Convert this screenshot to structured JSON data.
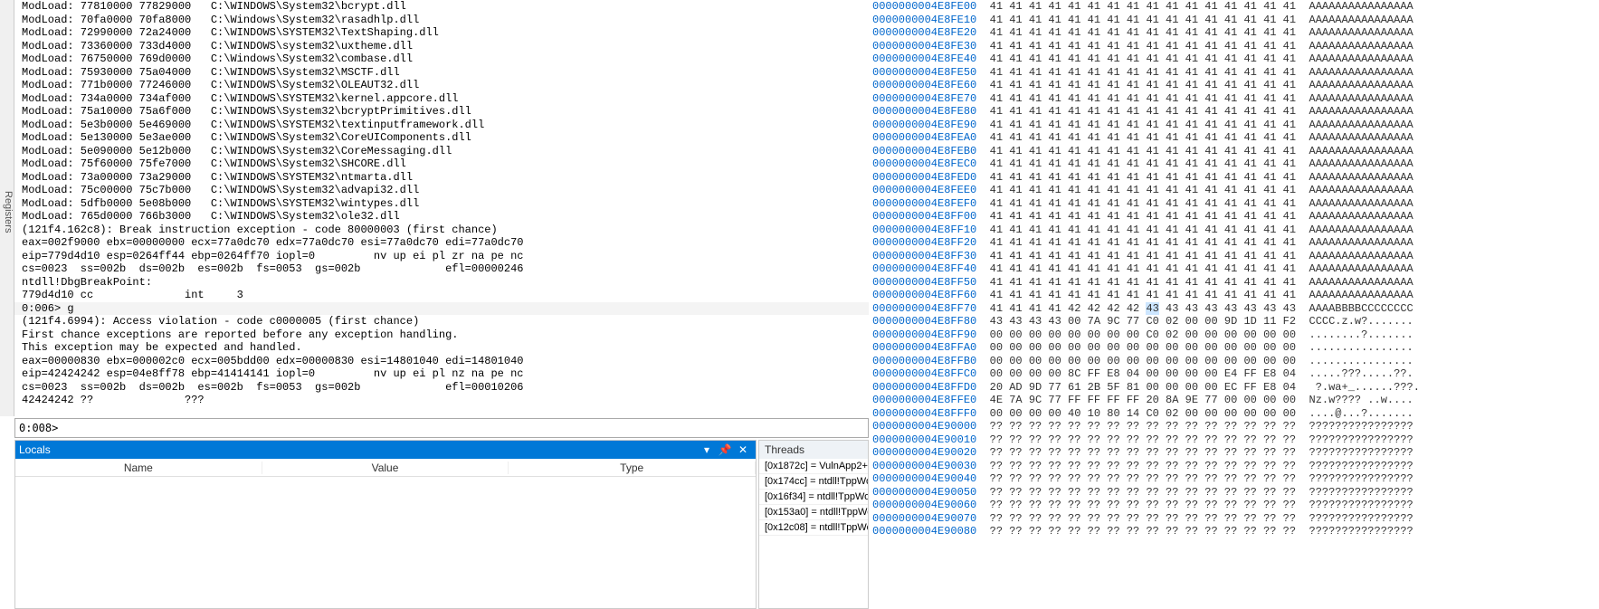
{
  "sidebar": {
    "label": "Registers"
  },
  "command_lines": [
    {
      "t": "ModLoad: 77810000 77829000   C:\\WINDOWS\\System32\\bcrypt.dll"
    },
    {
      "t": "ModLoad: 70fa0000 70fa8000   C:\\Windows\\System32\\rasadhlp.dll"
    },
    {
      "t": "ModLoad: 72990000 72a24000   C:\\WINDOWS\\SYSTEM32\\TextShaping.dll"
    },
    {
      "t": "ModLoad: 73360000 733d4000   C:\\WINDOWS\\system32\\uxtheme.dll"
    },
    {
      "t": "ModLoad: 76750000 769d0000   C:\\Windows\\System32\\combase.dll"
    },
    {
      "t": "ModLoad: 75930000 75a04000   C:\\WINDOWS\\System32\\MSCTF.dll"
    },
    {
      "t": "ModLoad: 771b0000 77246000   C:\\WINDOWS\\System32\\OLEAUT32.dll"
    },
    {
      "t": "ModLoad: 734a0000 734af000   C:\\WINDOWS\\SYSTEM32\\kernel.appcore.dll"
    },
    {
      "t": "ModLoad: 75a10000 75a6f000   C:\\WINDOWS\\System32\\bcryptPrimitives.dll"
    },
    {
      "t": "ModLoad: 5e3b0000 5e469000   C:\\WINDOWS\\SYSTEM32\\textinputframework.dll"
    },
    {
      "t": "ModLoad: 5e130000 5e3ae000   C:\\WINDOWS\\System32\\CoreUIComponents.dll"
    },
    {
      "t": "ModLoad: 5e090000 5e12b000   C:\\WINDOWS\\System32\\CoreMessaging.dll"
    },
    {
      "t": "ModLoad: 75f60000 75fe7000   C:\\WINDOWS\\System32\\SHCORE.dll"
    },
    {
      "t": "ModLoad: 73a00000 73a29000   C:\\WINDOWS\\SYSTEM32\\ntmarta.dll"
    },
    {
      "t": "ModLoad: 75c00000 75c7b000   C:\\WINDOWS\\System32\\advapi32.dll"
    },
    {
      "t": "ModLoad: 5dfb0000 5e08b000   C:\\WINDOWS\\SYSTEM32\\wintypes.dll"
    },
    {
      "t": "ModLoad: 765d0000 766b3000   C:\\WINDOWS\\System32\\ole32.dll"
    },
    {
      "t": "(121f4.162c8): Break instruction exception - code 80000003 (first chance)"
    },
    {
      "t": "eax=002f9000 ebx=00000000 ecx=77a0dc70 edx=77a0dc70 esi=77a0dc70 edi=77a0dc70"
    },
    {
      "t": "eip=779d4d10 esp=0264ff44 ebp=0264ff70 iopl=0         nv up ei pl zr na pe nc"
    },
    {
      "t": "cs=0023  ss=002b  ds=002b  es=002b  fs=0053  gs=002b             efl=00000246"
    },
    {
      "t": "ntdll!DbgBreakPoint:"
    },
    {
      "t": "779d4d10 cc              int     3"
    },
    {
      "t": "0:006> g",
      "hl": true
    },
    {
      "t": "(121f4.6994): Access violation - code c0000005 (first chance)"
    },
    {
      "t": "First chance exceptions are reported before any exception handling."
    },
    {
      "t": "This exception may be expected and handled."
    },
    {
      "t": "eax=00000830 ebx=000002c0 ecx=005bdd00 edx=00000830 esi=14801040 edi=14801040"
    },
    {
      "t": "eip=42424242 esp=04e8ff78 ebp=41414141 iopl=0         nv up ei pl nz na pe nc"
    },
    {
      "t": "cs=0023  ss=002b  ds=002b  es=002b  fs=0053  gs=002b             efl=00010206"
    },
    {
      "t": "42424242 ??              ???"
    }
  ],
  "prompt": "0:008>",
  "input_value": "",
  "locals": {
    "title": "Locals",
    "columns": [
      "Name",
      "Value",
      "Type"
    ]
  },
  "threads": {
    "title": "Threads",
    "items": [
      "[0x1872c] = VulnApp2+",
      "[0x174cc] = ntdll!TppWo",
      "[0x16f34] = ntdll!TppWo",
      "[0x153a0] = ntdll!TppWo",
      "[0x12c08] = ntdll!TppWo"
    ]
  },
  "memory": {
    "rows": [
      {
        "addr": "0000000004E8FE00",
        "hex": "41 41 41 41 41 41 41 41 41 41 41 41 41 41 41 41",
        "asc": "AAAAAAAAAAAAAAAA"
      },
      {
        "addr": "0000000004E8FE10",
        "hex": "41 41 41 41 41 41 41 41 41 41 41 41 41 41 41 41",
        "asc": "AAAAAAAAAAAAAAAA"
      },
      {
        "addr": "0000000004E8FE20",
        "hex": "41 41 41 41 41 41 41 41 41 41 41 41 41 41 41 41",
        "asc": "AAAAAAAAAAAAAAAA"
      },
      {
        "addr": "0000000004E8FE30",
        "hex": "41 41 41 41 41 41 41 41 41 41 41 41 41 41 41 41",
        "asc": "AAAAAAAAAAAAAAAA"
      },
      {
        "addr": "0000000004E8FE40",
        "hex": "41 41 41 41 41 41 41 41 41 41 41 41 41 41 41 41",
        "asc": "AAAAAAAAAAAAAAAA"
      },
      {
        "addr": "0000000004E8FE50",
        "hex": "41 41 41 41 41 41 41 41 41 41 41 41 41 41 41 41",
        "asc": "AAAAAAAAAAAAAAAA"
      },
      {
        "addr": "0000000004E8FE60",
        "hex": "41 41 41 41 41 41 41 41 41 41 41 41 41 41 41 41",
        "asc": "AAAAAAAAAAAAAAAA"
      },
      {
        "addr": "0000000004E8FE70",
        "hex": "41 41 41 41 41 41 41 41 41 41 41 41 41 41 41 41",
        "asc": "AAAAAAAAAAAAAAAA"
      },
      {
        "addr": "0000000004E8FE80",
        "hex": "41 41 41 41 41 41 41 41 41 41 41 41 41 41 41 41",
        "asc": "AAAAAAAAAAAAAAAA"
      },
      {
        "addr": "0000000004E8FE90",
        "hex": "41 41 41 41 41 41 41 41 41 41 41 41 41 41 41 41",
        "asc": "AAAAAAAAAAAAAAAA"
      },
      {
        "addr": "0000000004E8FEA0",
        "hex": "41 41 41 41 41 41 41 41 41 41 41 41 41 41 41 41",
        "asc": "AAAAAAAAAAAAAAAA"
      },
      {
        "addr": "0000000004E8FEB0",
        "hex": "41 41 41 41 41 41 41 41 41 41 41 41 41 41 41 41",
        "asc": "AAAAAAAAAAAAAAAA"
      },
      {
        "addr": "0000000004E8FEC0",
        "hex": "41 41 41 41 41 41 41 41 41 41 41 41 41 41 41 41",
        "asc": "AAAAAAAAAAAAAAAA"
      },
      {
        "addr": "0000000004E8FED0",
        "hex": "41 41 41 41 41 41 41 41 41 41 41 41 41 41 41 41",
        "asc": "AAAAAAAAAAAAAAAA"
      },
      {
        "addr": "0000000004E8FEE0",
        "hex": "41 41 41 41 41 41 41 41 41 41 41 41 41 41 41 41",
        "asc": "AAAAAAAAAAAAAAAA"
      },
      {
        "addr": "0000000004E8FEF0",
        "hex": "41 41 41 41 41 41 41 41 41 41 41 41 41 41 41 41",
        "asc": "AAAAAAAAAAAAAAAA"
      },
      {
        "addr": "0000000004E8FF00",
        "hex": "41 41 41 41 41 41 41 41 41 41 41 41 41 41 41 41",
        "asc": "AAAAAAAAAAAAAAAA"
      },
      {
        "addr": "0000000004E8FF10",
        "hex": "41 41 41 41 41 41 41 41 41 41 41 41 41 41 41 41",
        "asc": "AAAAAAAAAAAAAAAA"
      },
      {
        "addr": "0000000004E8FF20",
        "hex": "41 41 41 41 41 41 41 41 41 41 41 41 41 41 41 41",
        "asc": "AAAAAAAAAAAAAAAA"
      },
      {
        "addr": "0000000004E8FF30",
        "hex": "41 41 41 41 41 41 41 41 41 41 41 41 41 41 41 41",
        "asc": "AAAAAAAAAAAAAAAA"
      },
      {
        "addr": "0000000004E8FF40",
        "hex": "41 41 41 41 41 41 41 41 41 41 41 41 41 41 41 41",
        "asc": "AAAAAAAAAAAAAAAA"
      },
      {
        "addr": "0000000004E8FF50",
        "hex": "41 41 41 41 41 41 41 41 41 41 41 41 41 41 41 41",
        "asc": "AAAAAAAAAAAAAAAA"
      },
      {
        "addr": "0000000004E8FF60",
        "hex": "41 41 41 41 41 41 41 41 41 41 41 41 41 41 41 41",
        "asc": "AAAAAAAAAAAAAAAA"
      },
      {
        "addr": "0000000004E8FF70",
        "hex": "41 41 41 41 42 42 42 42 ",
        "hex_hl": "43",
        "hex2": " 43 43 43 43 43 43 43",
        "asc": "AAAABBBBCCCCCCCC"
      },
      {
        "addr": "0000000004E8FF80",
        "hex": "43 43 43 43 00 7A 9C 77 C0 02 00 00 9D 1D 11 F2",
        "asc": "CCCC.z.w?......."
      },
      {
        "addr": "0000000004E8FF90",
        "hex": "00 00 00 00 00 00 00 00 C0 02 00 00 00 00 00 00",
        "asc": "........?......."
      },
      {
        "addr": "0000000004E8FFA0",
        "hex": "00 00 00 00 00 00 00 00 00 00 00 00 00 00 00 00",
        "asc": "................"
      },
      {
        "addr": "0000000004E8FFB0",
        "hex": "00 00 00 00 00 00 00 00 00 00 00 00 00 00 00 00",
        "asc": "................"
      },
      {
        "addr": "0000000004E8FFC0",
        "hex": "00 00 00 00 8C FF E8 04 00 00 00 00 E4 FF E8 04",
        "asc": ".....???.....??."
      },
      {
        "addr": "0000000004E8FFD0",
        "hex": "20 AD 9D 77 61 2B 5F 81 00 00 00 00 EC FF E8 04",
        "asc": " ?.wa+_......???."
      },
      {
        "addr": "0000000004E8FFE0",
        "hex": "4E 7A 9C 77 FF FF FF FF 20 8A 9E 77 00 00 00 00",
        "asc": "Nz.w???? ..w...."
      },
      {
        "addr": "0000000004E8FFF0",
        "hex": "00 00 00 00 40 10 80 14 C0 02 00 00 00 00 00 00",
        "asc": "....@...?......."
      },
      {
        "addr": "0000000004E90000",
        "hex": "?? ?? ?? ?? ?? ?? ?? ?? ?? ?? ?? ?? ?? ?? ?? ??",
        "asc": "????????????????"
      },
      {
        "addr": "0000000004E90010",
        "hex": "?? ?? ?? ?? ?? ?? ?? ?? ?? ?? ?? ?? ?? ?? ?? ??",
        "asc": "????????????????"
      },
      {
        "addr": "0000000004E90020",
        "hex": "?? ?? ?? ?? ?? ?? ?? ?? ?? ?? ?? ?? ?? ?? ?? ??",
        "asc": "????????????????"
      },
      {
        "addr": "0000000004E90030",
        "hex": "?? ?? ?? ?? ?? ?? ?? ?? ?? ?? ?? ?? ?? ?? ?? ??",
        "asc": "????????????????"
      },
      {
        "addr": "0000000004E90040",
        "hex": "?? ?? ?? ?? ?? ?? ?? ?? ?? ?? ?? ?? ?? ?? ?? ??",
        "asc": "????????????????"
      },
      {
        "addr": "0000000004E90050",
        "hex": "?? ?? ?? ?? ?? ?? ?? ?? ?? ?? ?? ?? ?? ?? ?? ??",
        "asc": "????????????????"
      },
      {
        "addr": "0000000004E90060",
        "hex": "?? ?? ?? ?? ?? ?? ?? ?? ?? ?? ?? ?? ?? ?? ?? ??",
        "asc": "????????????????"
      },
      {
        "addr": "0000000004E90070",
        "hex": "?? ?? ?? ?? ?? ?? ?? ?? ?? ?? ?? ?? ?? ?? ?? ??",
        "asc": "????????????????"
      },
      {
        "addr": "0000000004E90080",
        "hex": "?? ?? ?? ?? ?? ?? ?? ?? ?? ?? ?? ?? ?? ?? ?? ??",
        "asc": "????????????????"
      }
    ]
  },
  "icons": {
    "dropdown": "▾",
    "pin": "📌",
    "close": "✕"
  }
}
